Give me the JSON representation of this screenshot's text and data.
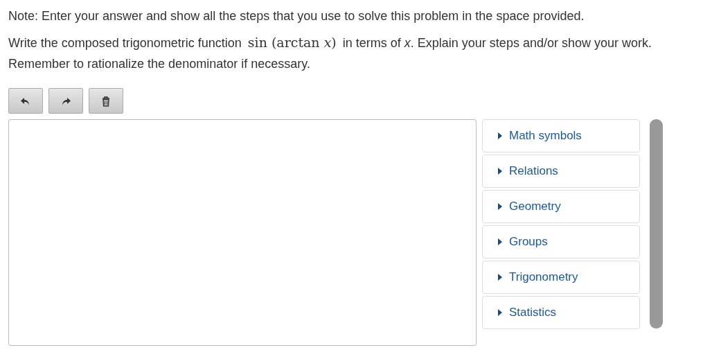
{
  "note": "Note: Enter your answer and show all the steps that you use to solve this problem in the space provided.",
  "question": {
    "before": "Write the composed trigonometric function",
    "math": "sin (arctan *x*)",
    "after": "in terms of *x*. Explain your steps and/or show your work. Remember to rationalize the denominator if necessary."
  },
  "toolbar": [
    {
      "kind": "undo"
    },
    {
      "kind": "redo"
    },
    {
      "kind": "clear"
    }
  ],
  "palette": [
    {
      "label": "Math symbols",
      "expanded": false
    },
    {
      "label": "Relations",
      "expanded": false
    },
    {
      "label": "Geometry",
      "expanded": false
    },
    {
      "label": "Groups",
      "expanded": false
    },
    {
      "label": "Trigonometry",
      "expanded": false
    },
    {
      "label": "Statistics",
      "expanded": false
    }
  ]
}
